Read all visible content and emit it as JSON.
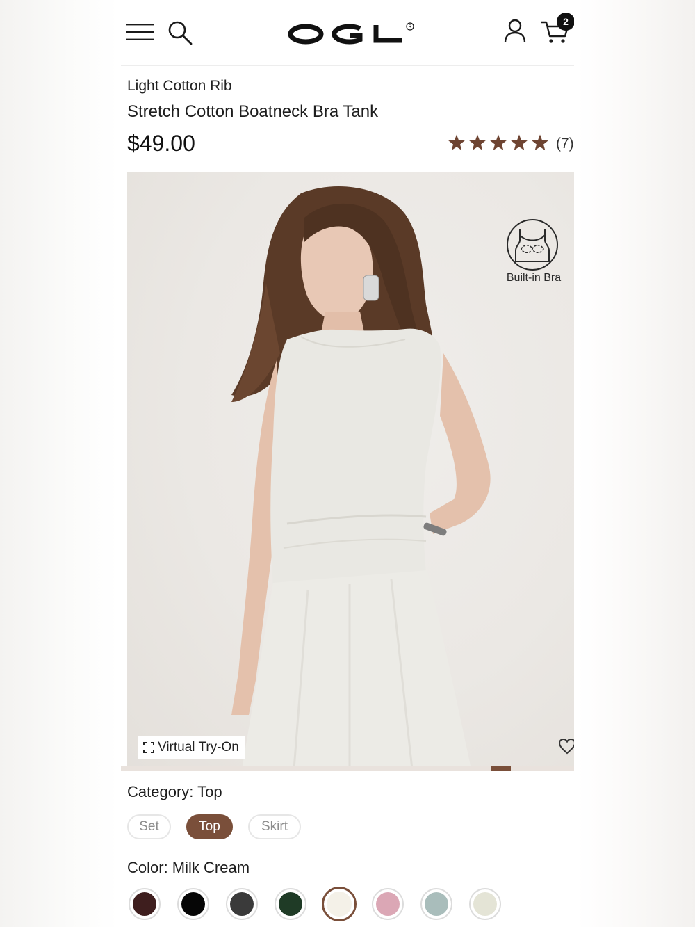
{
  "header": {
    "logo_text": "OGL",
    "logo_mark": "®",
    "cart_count": "2",
    "icons": [
      "menu-icon",
      "search-icon",
      "account-icon",
      "cart-icon"
    ]
  },
  "product": {
    "collection": "Light Cotton Rib",
    "title": "Stretch Cotton Boatneck Bra Tank",
    "price": "$49.00",
    "rating_stars": 5,
    "review_count": "(7)"
  },
  "image": {
    "badge_label": "Built-in Bra",
    "tryon_label": "Virtual Try-On",
    "gallery_position": 0.88
  },
  "options": {
    "category_label": "Category: Top",
    "categories": [
      "Set",
      "Top",
      "Skirt"
    ],
    "selected_category": "Top",
    "color_label": "Color: Milk Cream",
    "colors": [
      {
        "name": "burgundy",
        "hex": "#3e1e1e"
      },
      {
        "name": "black",
        "hex": "#060606"
      },
      {
        "name": "charcoal",
        "hex": "#3a3a3a"
      },
      {
        "name": "forest green",
        "hex": "#1f3b26"
      },
      {
        "name": "milk cream",
        "hex": "#f4f1e8",
        "selected": true
      },
      {
        "name": "pink",
        "hex": "#dba7b5"
      },
      {
        "name": "sage blue",
        "hex": "#a9bdbb"
      },
      {
        "name": "beige",
        "hex": "#e4e4d6"
      }
    ]
  },
  "theme": {
    "accent": "#7a4f3a",
    "star_color": "#6e4432"
  }
}
